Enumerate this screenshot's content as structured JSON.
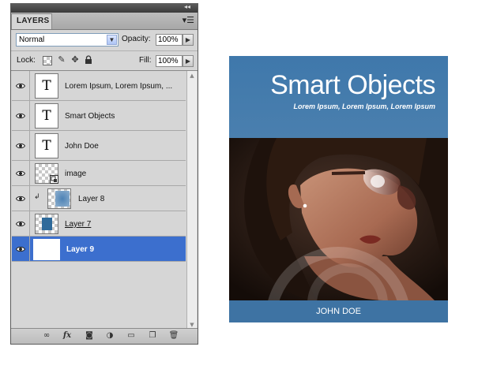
{
  "panel": {
    "tab_label": "LAYERS",
    "blend_mode": "Normal",
    "opacity_label": "Opacity:",
    "opacity_value": "100%",
    "lock_label": "Lock:",
    "fill_label": "Fill:",
    "fill_value": "100%"
  },
  "layers": [
    {
      "name": "Lorem Ipsum, Lorem Ipsum, ...",
      "kind": "text",
      "visible": true,
      "selected": false
    },
    {
      "name": "Smart Objects",
      "kind": "text",
      "visible": true,
      "selected": false
    },
    {
      "name": "John Doe",
      "kind": "text",
      "visible": true,
      "selected": false
    },
    {
      "name": "image",
      "kind": "smart-object",
      "visible": true,
      "selected": false
    },
    {
      "name": "Layer 8",
      "kind": "clipped",
      "visible": true,
      "selected": false
    },
    {
      "name": "Layer 7",
      "kind": "raster",
      "visible": true,
      "selected": false
    },
    {
      "name": "Layer 9",
      "kind": "raster",
      "visible": true,
      "selected": true
    }
  ],
  "thumb_text": "T",
  "cover": {
    "title": "Smart Objects",
    "subtitle": "Lorem Ipsum, Lorem Ipsum, Lorem Ipsum",
    "author": "JOHN DOE"
  },
  "colors": {
    "cover_blue": "#3f78ab",
    "selection_blue": "#3c6fce",
    "panel_gray": "#d6d6d6"
  },
  "icons": [
    "eye-icon",
    "link-icon",
    "fx-icon",
    "mask-icon",
    "adjustment-icon",
    "folder-icon",
    "new-layer-icon",
    "trash-icon"
  ]
}
